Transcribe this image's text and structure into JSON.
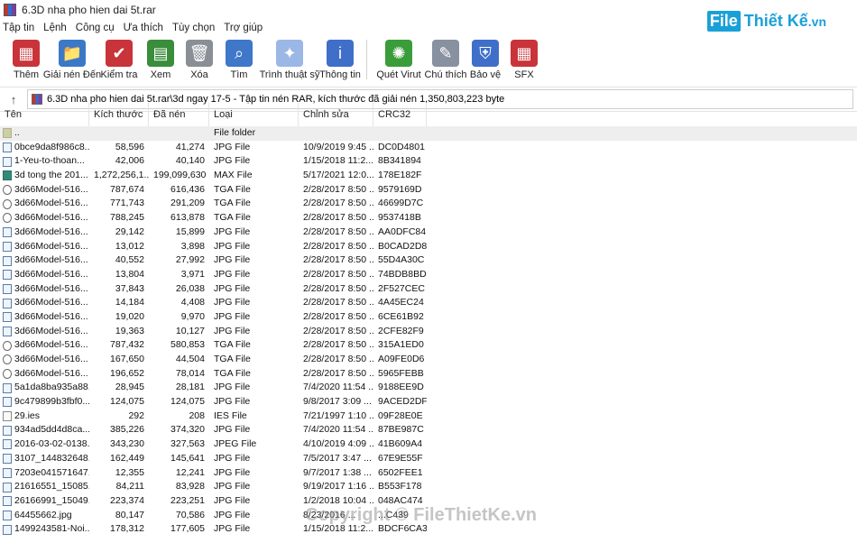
{
  "window": {
    "title": "6.3D nha pho hien dai 5t.rar"
  },
  "brand": {
    "file": "File",
    "name": "Thiết Kế",
    "domain": ".vn"
  },
  "menu": [
    "Tập tin",
    "Lệnh",
    "Công cụ",
    "Ưa thích",
    "Tùy chọn",
    "Trợ giúp"
  ],
  "toolbar": [
    {
      "label": "Thêm",
      "icon": "add-icon",
      "color": "#c9333a"
    },
    {
      "label": "Giải nén Đến",
      "icon": "extract-folder-icon",
      "color": "#3b79c8"
    },
    {
      "label": "Kiểm tra",
      "icon": "test-icon",
      "color": "#c9333a"
    },
    {
      "label": "Xem",
      "icon": "view-book-icon",
      "color": "#3a8d3a"
    },
    {
      "label": "Xóa",
      "icon": "trash-icon",
      "color": "#8a8f96"
    },
    {
      "label": "Tìm",
      "icon": "magnifier-icon",
      "color": "#3f77c9"
    },
    {
      "label": "Trình thuật sỹ",
      "icon": "wizard-wand-icon",
      "color": "#9bb7e6"
    },
    {
      "label": "Thông tin",
      "icon": "info-icon",
      "color": "#3f6fc8"
    },
    {
      "label": "Quét Virut",
      "icon": "virus-scan-icon",
      "color": "#3a9d3a"
    },
    {
      "label": "Chú thích",
      "icon": "comment-icon",
      "color": "#8791a0"
    },
    {
      "label": "Bảo vệ",
      "icon": "shield-icon",
      "color": "#3f6fc8"
    },
    {
      "label": "SFX",
      "icon": "sfx-icon",
      "color": "#c9333a"
    }
  ],
  "address": {
    "path": "6.3D nha pho hien dai 5t.rar\\3d ngay 17-5 - Tập tin nén RAR, kích thước đã giải nén 1,350,803,223 byte"
  },
  "columns": [
    "Tên",
    "Kích thước",
    "Đã nén",
    "Loại",
    "Chỉnh sửa",
    "CRC32"
  ],
  "files": [
    {
      "name": "..",
      "size": "",
      "packed": "",
      "type": "File folder",
      "modified": "",
      "crc": "",
      "kind": "fold"
    },
    {
      "name": "0bce9da8f986c8...",
      "size": "58,596",
      "packed": "41,274",
      "type": "JPG File",
      "modified": "10/9/2019 9:45 ...",
      "crc": "DC0D4801",
      "kind": "jpg"
    },
    {
      "name": "1-Yeu-to-thoan...",
      "size": "42,006",
      "packed": "40,140",
      "type": "JPG File",
      "modified": "1/15/2018 11:2...",
      "crc": "8B341894",
      "kind": "jpg"
    },
    {
      "name": "3d tong the 201...",
      "size": "1,272,256,1...",
      "packed": "199,099,630",
      "type": "MAX File",
      "modified": "5/17/2021 12:0...",
      "crc": "178E182F",
      "kind": "max"
    },
    {
      "name": "3d66Model-516...",
      "size": "787,674",
      "packed": "616,436",
      "type": "TGA File",
      "modified": "2/28/2017 8:50 ...",
      "crc": "9579169D",
      "kind": "tga"
    },
    {
      "name": "3d66Model-516...",
      "size": "771,743",
      "packed": "291,209",
      "type": "TGA File",
      "modified": "2/28/2017 8:50 ...",
      "crc": "46699D7C",
      "kind": "tga"
    },
    {
      "name": "3d66Model-516...",
      "size": "788,245",
      "packed": "613,878",
      "type": "TGA File",
      "modified": "2/28/2017 8:50 ...",
      "crc": "9537418B",
      "kind": "tga"
    },
    {
      "name": "3d66Model-516...",
      "size": "29,142",
      "packed": "15,899",
      "type": "JPG File",
      "modified": "2/28/2017 8:50 ...",
      "crc": "AA0DFC84",
      "kind": "jpg"
    },
    {
      "name": "3d66Model-516...",
      "size": "13,012",
      "packed": "3,898",
      "type": "JPG File",
      "modified": "2/28/2017 8:50 ...",
      "crc": "B0CAD2D8",
      "kind": "jpg"
    },
    {
      "name": "3d66Model-516...",
      "size": "40,552",
      "packed": "27,992",
      "type": "JPG File",
      "modified": "2/28/2017 8:50 ...",
      "crc": "55D4A30C",
      "kind": "jpg"
    },
    {
      "name": "3d66Model-516...",
      "size": "13,804",
      "packed": "3,971",
      "type": "JPG File",
      "modified": "2/28/2017 8:50 ...",
      "crc": "74BDB8BD",
      "kind": "jpg"
    },
    {
      "name": "3d66Model-516...",
      "size": "37,843",
      "packed": "26,038",
      "type": "JPG File",
      "modified": "2/28/2017 8:50 ...",
      "crc": "2F527CEC",
      "kind": "jpg"
    },
    {
      "name": "3d66Model-516...",
      "size": "14,184",
      "packed": "4,408",
      "type": "JPG File",
      "modified": "2/28/2017 8:50 ...",
      "crc": "4A45EC24",
      "kind": "jpg"
    },
    {
      "name": "3d66Model-516...",
      "size": "19,020",
      "packed": "9,970",
      "type": "JPG File",
      "modified": "2/28/2017 8:50 ...",
      "crc": "6CE61B92",
      "kind": "jpg"
    },
    {
      "name": "3d66Model-516...",
      "size": "19,363",
      "packed": "10,127",
      "type": "JPG File",
      "modified": "2/28/2017 8:50 ...",
      "crc": "2CFE82F9",
      "kind": "jpg"
    },
    {
      "name": "3d66Model-516...",
      "size": "787,432",
      "packed": "580,853",
      "type": "TGA File",
      "modified": "2/28/2017 8:50 ...",
      "crc": "315A1ED0",
      "kind": "tga"
    },
    {
      "name": "3d66Model-516...",
      "size": "167,650",
      "packed": "44,504",
      "type": "TGA File",
      "modified": "2/28/2017 8:50 ...",
      "crc": "A09FE0D6",
      "kind": "tga"
    },
    {
      "name": "3d66Model-516...",
      "size": "196,652",
      "packed": "78,014",
      "type": "TGA File",
      "modified": "2/28/2017 8:50 ...",
      "crc": "5965FEBB",
      "kind": "tga"
    },
    {
      "name": "5a1da8ba935a88...",
      "size": "28,945",
      "packed": "28,181",
      "type": "JPG File",
      "modified": "7/4/2020 11:54 ...",
      "crc": "9188EE9D",
      "kind": "jpg"
    },
    {
      "name": "9c479899b3fbf0...",
      "size": "124,075",
      "packed": "124,075",
      "type": "JPG File",
      "modified": "9/8/2017 3:09 ...",
      "crc": "9ACED2DF",
      "kind": "jpg"
    },
    {
      "name": "29.ies",
      "size": "292",
      "packed": "208",
      "type": "IES File",
      "modified": "7/21/1997 1:10 ...",
      "crc": "09F28E0E",
      "kind": "ies"
    },
    {
      "name": "934ad5dd4d8ca...",
      "size": "385,226",
      "packed": "374,320",
      "type": "JPG File",
      "modified": "7/4/2020 11:54 ...",
      "crc": "87BE987C",
      "kind": "jpg"
    },
    {
      "name": "2016-03-02-0138...",
      "size": "343,230",
      "packed": "327,563",
      "type": "JPEG File",
      "modified": "4/10/2019 4:09 ...",
      "crc": "41B609A4",
      "kind": "jpg"
    },
    {
      "name": "3107_144832648...",
      "size": "162,449",
      "packed": "145,641",
      "type": "JPG File",
      "modified": "7/5/2017 3:47 ...",
      "crc": "67E9E55F",
      "kind": "jpg"
    },
    {
      "name": "7203e041571647...",
      "size": "12,355",
      "packed": "12,241",
      "type": "JPG File",
      "modified": "9/7/2017 1:38 ...",
      "crc": "6502FEE1",
      "kind": "jpg"
    },
    {
      "name": "21616551_15085...",
      "size": "84,211",
      "packed": "83,928",
      "type": "JPG File",
      "modified": "9/19/2017 1:16 ...",
      "crc": "B553F178",
      "kind": "jpg"
    },
    {
      "name": "26166991_15049...",
      "size": "223,374",
      "packed": "223,251",
      "type": "JPG File",
      "modified": "1/2/2018 10:04 ...",
      "crc": "048AC474",
      "kind": "jpg"
    },
    {
      "name": "64455662.jpg",
      "size": "80,147",
      "packed": "70,586",
      "type": "JPG File",
      "modified": "8/23/2016 ...",
      "crc": "...C439",
      "kind": "jpg"
    },
    {
      "name": "1499243581-Noi...",
      "size": "178,312",
      "packed": "177,605",
      "type": "JPG File",
      "modified": "1/15/2018 11:2...",
      "crc": "BDCF6CA3",
      "kind": "jpg"
    }
  ],
  "watermark": "Copyright © FileThietKe.vn"
}
